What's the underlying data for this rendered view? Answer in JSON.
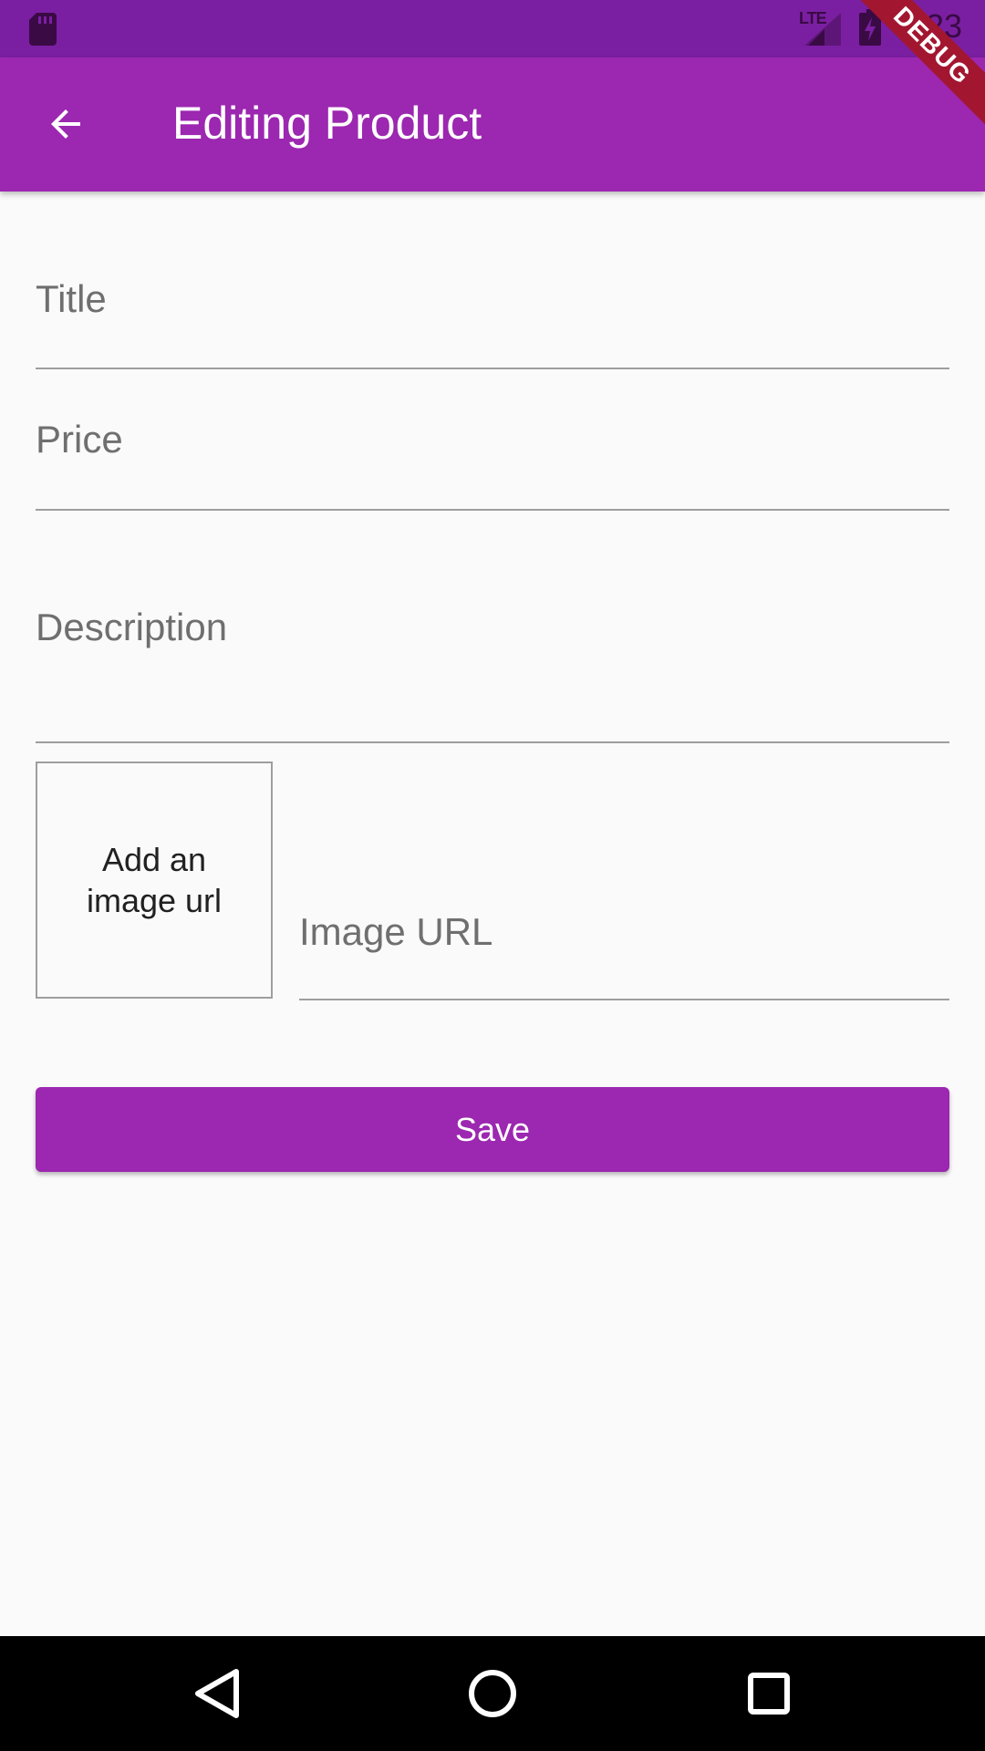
{
  "status_bar": {
    "network": "LTE",
    "time": "2:23",
    "icons": [
      "sd-card-icon",
      "signal-icon",
      "battery-charging-icon"
    ]
  },
  "app_bar": {
    "title": "Editing Product",
    "back_icon": "arrow-back-icon",
    "debug_banner": "DEBUG",
    "color": "#9c27b0"
  },
  "form": {
    "title_field": {
      "label": "Title",
      "value": ""
    },
    "price_field": {
      "label": "Price",
      "value": ""
    },
    "description_field": {
      "label": "Description",
      "value": ""
    },
    "image_preview": {
      "placeholder": "Add an image url"
    },
    "image_url_field": {
      "label": "Image URL",
      "value": ""
    },
    "save_button": {
      "label": "Save"
    }
  },
  "nav_bar": {
    "icons": [
      "nav-back-icon",
      "nav-home-icon",
      "nav-recents-icon"
    ]
  },
  "colors": {
    "status_bar": "#7b1fa2",
    "primary": "#9c27b0",
    "background": "#fafafa",
    "debug_banner": "#a31630"
  }
}
